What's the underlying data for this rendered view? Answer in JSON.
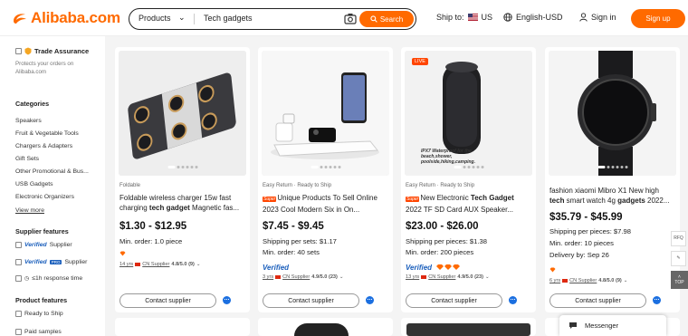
{
  "header": {
    "logo": "Alibaba.com",
    "search_type": "Products",
    "search_query": "Tech gadgets",
    "search_button": "Search",
    "ship_to_label": "Ship to:",
    "ship_to_country": "US",
    "language": "English-USD",
    "sign_in": "Sign in",
    "sign_up": "Sign up"
  },
  "sidebar": {
    "trade_assurance": "Trade Assurance",
    "trade_assurance_desc": "Protects your orders on Alibaba.com",
    "categories_title": "Categories",
    "categories": [
      "Speakers",
      "Fruit & Vegetable Tools",
      "Chargers & Adapters",
      "Gift Sets",
      "Other Promotional & Bus...",
      "USB Gadgets",
      "Electronic Organizers"
    ],
    "view_more": "View more",
    "supplier_features_title": "Supplier features",
    "verified": "Verified",
    "pro": "PRO",
    "supplier_word": "Supplier",
    "response_time": "≤1h response time",
    "product_features_title": "Product features",
    "ready_to_ship": "Ready to Ship",
    "paid_samples": "Paid samples"
  },
  "topbar_text": "...",
  "products": [
    {
      "tagline": "Foldable",
      "title_a": "Foldable wireless charger 15w fast charging ",
      "title_b": "tech gadget",
      "title_c": " Magnetic fas...",
      "price": "$1.30 - $12.95",
      "line1": "Min. order: 1.0 piece",
      "line2": "",
      "supplier_years": "14 yrs",
      "supplier_country": "CN Supplier",
      "rating": "4.8/5.0 (9)",
      "contact": "Contact supplier"
    },
    {
      "tagline": "Easy Return · Ready to Ship",
      "super": "Super",
      "title_a": "Unique Products To Sell Online 2023 Cool Modern Six in On...",
      "price": "$7.45 - $9.45",
      "line1": "Shipping per sets: $1.17",
      "line2": "Min. order: 40 sets",
      "verified": "Verified",
      "supplier_years": "3 yrs",
      "supplier_country": "CN Supplier",
      "rating": "4.9/5.0 (23)",
      "contact": "Contact supplier"
    },
    {
      "tagline": "Easy Return · Ready to Ship",
      "live": "LIVE",
      "promo": "IPX7 Waterproof for the beach,shower, poolside,hiking,camping.",
      "super": "Super",
      "title_a": "New Electronic ",
      "title_b": "Tech Gadget",
      "title_c": " 2022 TF SD Card AUX Speaker...",
      "price": "$23.00 - $26.00",
      "line1": "Shipping per pieces: $1.38",
      "line2": "Min. order: 200 pieces",
      "verified": "Verified",
      "supplier_years": "13 yrs",
      "supplier_country": "CN Supplier",
      "rating": "4.9/5.0 (23)",
      "contact": "Contact supplier"
    },
    {
      "tagline": "",
      "title_a": "fashion xiaomi Mibro X1 New high ",
      "title_b": "tech",
      "title_c": " smart watch 4g ",
      "title_d": "gadgets",
      "title_e": " 2022...",
      "price": "$35.79 - $45.99",
      "line1": "Shipping per pieces: $7.98",
      "line2": "Min. order: 10 pieces",
      "line3": "Delivery by: Sep 26",
      "supplier_years": "6 yrs",
      "supplier_country": "CN Supplier",
      "rating": "4.8/5.0 (9)",
      "contact": "Contact supplier"
    }
  ],
  "right_tools": {
    "rfq": "RFQ",
    "top": "TOP"
  },
  "messenger": "Messenger",
  "colors": {
    "brand": "#ff6a00",
    "verified": "#1b5fbc"
  }
}
